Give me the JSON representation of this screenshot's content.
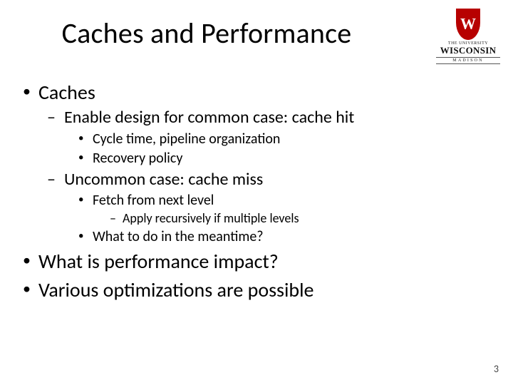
{
  "title": "Caches and Performance",
  "logo": {
    "line1": "THE UNIVERSITY",
    "line2": "WISCONSIN",
    "line3": "MADISON"
  },
  "bullets": {
    "b1": "Caches",
    "b1_1": "Enable design for common case: cache hit",
    "b1_1_1": "Cycle time, pipeline organization",
    "b1_1_2": "Recovery policy",
    "b1_2": "Uncommon case: cache miss",
    "b1_2_1": "Fetch from next level",
    "b1_2_1_1": "Apply recursively if multiple levels",
    "b1_2_2": "What to do in the meantime?",
    "b2": "What is performance impact?",
    "b3": "Various optimizations are possible"
  },
  "page_number": "3"
}
